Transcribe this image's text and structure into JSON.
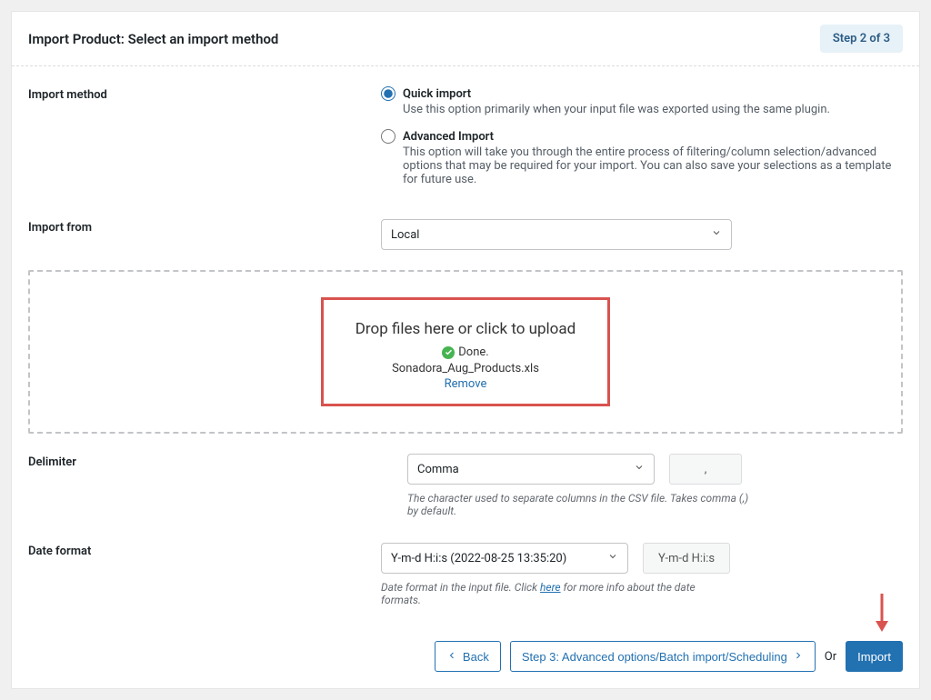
{
  "header": {
    "title": "Import Product: Select an import method",
    "step_badge": "Step 2 of 3"
  },
  "import_method": {
    "label": "Import method",
    "quick": {
      "title": "Quick import",
      "desc": "Use this option primarily when your input file was exported using the same plugin."
    },
    "advanced": {
      "title": "Advanced Import",
      "desc": "This option will take you through the entire process of filtering/column selection/advanced options that may be required for your import. You can also save your selections as a template for future use."
    }
  },
  "import_from": {
    "label": "Import from",
    "selected": "Local"
  },
  "dropzone": {
    "title": "Drop files here or click to upload",
    "done_label": "Done.",
    "filename": "Sonadora_Aug_Products.xls",
    "remove_label": "Remove"
  },
  "delimiter": {
    "label": "Delimiter",
    "selected": "Comma",
    "example": ",",
    "helper": "The character used to separate columns in the CSV file. Takes comma (,) by default."
  },
  "date_format": {
    "label": "Date format",
    "selected": "Y-m-d H:i:s (2022-08-25 13:35:20)",
    "example": "Y-m-d H:i:s",
    "helper_prefix": "Date format in the input file. Click ",
    "helper_link": "here",
    "helper_suffix": " for more info about the date formats."
  },
  "footer": {
    "back": "Back",
    "next": "Step 3: Advanced options/Batch import/Scheduling",
    "or": "Or",
    "import": "Import"
  }
}
